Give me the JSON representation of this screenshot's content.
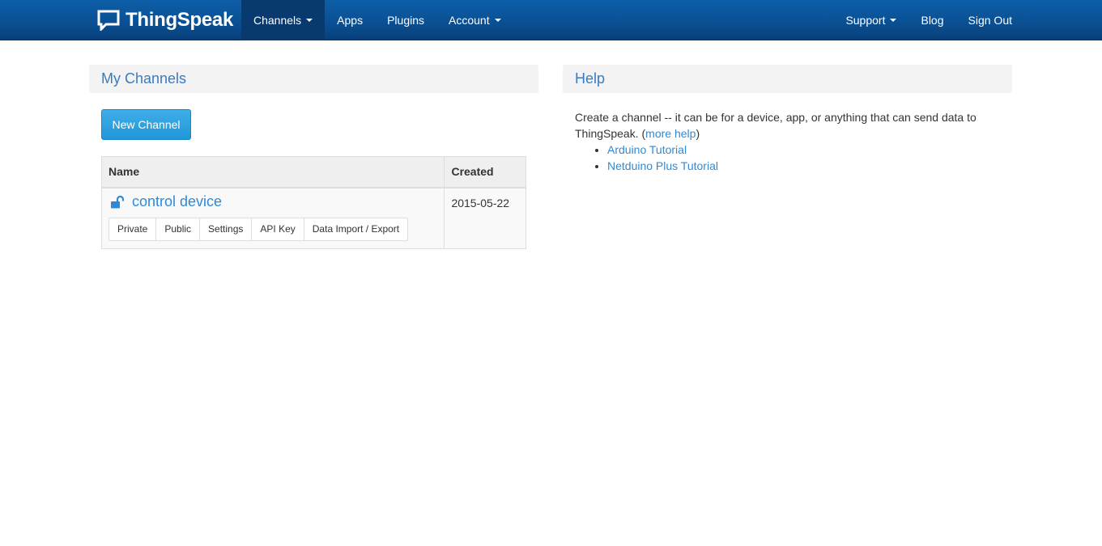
{
  "navbar": {
    "brand": "ThingSpeak",
    "left_items": [
      {
        "label": "Channels",
        "dropdown": true,
        "active": true
      },
      {
        "label": "Apps",
        "dropdown": false
      },
      {
        "label": "Plugins",
        "dropdown": false
      },
      {
        "label": "Account",
        "dropdown": true
      }
    ],
    "right_items": [
      {
        "label": "Support",
        "dropdown": true
      },
      {
        "label": "Blog",
        "dropdown": false
      },
      {
        "label": "Sign Out",
        "dropdown": false
      }
    ]
  },
  "my_channels": {
    "title": "My Channels",
    "new_channel_label": "New Channel",
    "table": {
      "columns": [
        "Name",
        "Created"
      ],
      "rows": [
        {
          "icon": "unlock-icon",
          "name": "control device",
          "created": "2015-05-22",
          "actions": [
            "Private",
            "Public",
            "Settings",
            "API Key",
            "Data Import / Export"
          ]
        }
      ]
    }
  },
  "help": {
    "title": "Help",
    "text_before": "Create a channel -- it can be for a device, app, or anything that can send data to ThingSpeak. (",
    "more_help_label": "more help",
    "text_after": ")",
    "links": [
      "Arduino Tutorial",
      "Netduino Plus Tutorial"
    ]
  },
  "colors": {
    "navbar": "#0a4f92",
    "navbar_active": "#083a70",
    "accent_link": "#2e8ad8",
    "panel_title": "#3a7bbd",
    "primary_button": "#2196d8"
  }
}
